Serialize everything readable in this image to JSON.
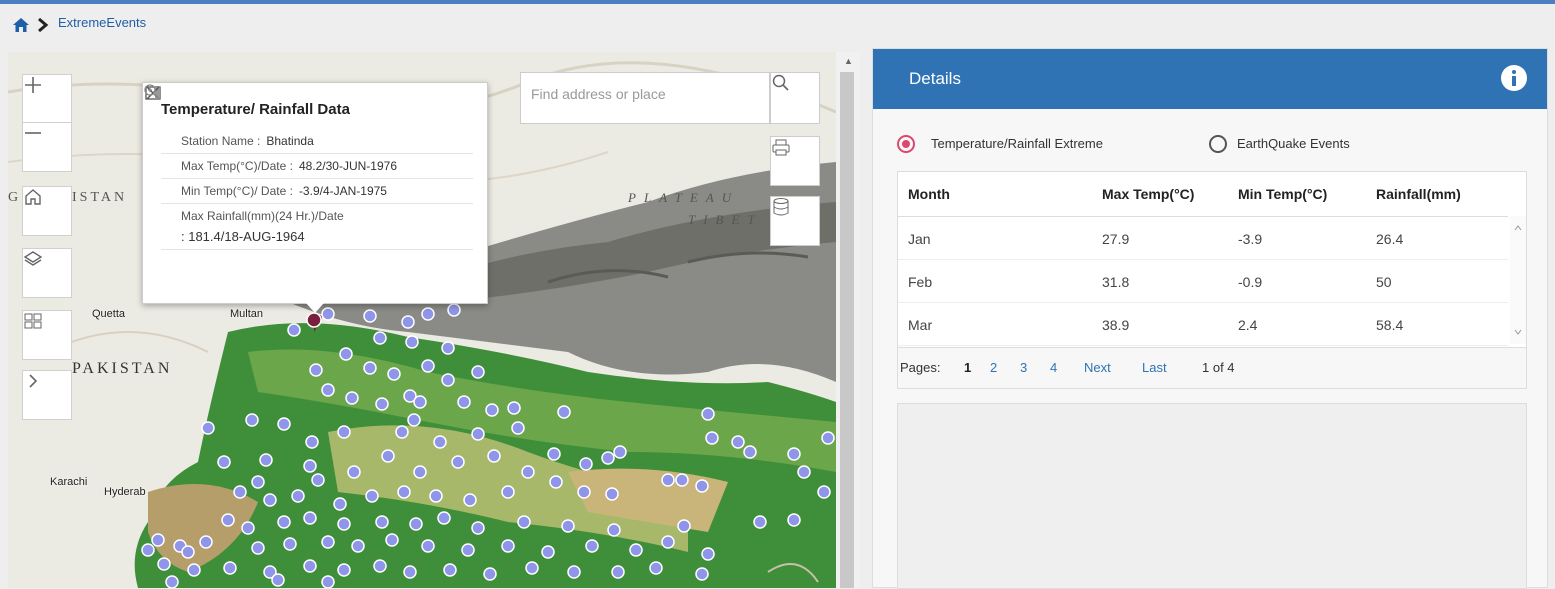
{
  "breadcrumb": {
    "home_icon": "home-icon",
    "current": "ExtremeEvents"
  },
  "map": {
    "labels": {
      "plateau1": "PLATEAU",
      "plateau2": "TIBET",
      "pakistan": "PAKISTAN",
      "stan": "ISTAN",
      "g": "G"
    },
    "cities": {
      "quetta": "Quetta",
      "multan": "Multan",
      "karachi": "Karachi",
      "hyderabad": "Hyderab"
    },
    "search": {
      "placeholder": "Find address or place"
    },
    "controls": [
      "zoom-in-icon",
      "zoom-out-icon",
      "home-icon",
      "layers-icon",
      "basemap-gallery-icon",
      "expand-icon",
      "search-icon",
      "print-icon",
      "database-icon"
    ],
    "popup": {
      "title": "Temperature/ Rainfall Data",
      "station_label": "Station Name :",
      "station_value": "Bhatinda",
      "max_temp_label": "Max Temp(°C)/Date :",
      "max_temp_value": "48.2/30-JUN-1976",
      "min_temp_label": "Min Temp(°C)/ Date :",
      "min_temp_value": "-3.9/4-JAN-1975",
      "rain_label": "Max Rainfall(mm)(24 Hr.)/Date",
      "rain_value": ":  181.4/18-AUG-1964"
    },
    "marker_color": "#8f95e8",
    "selected_marker_color": "#7a1f3d"
  },
  "details": {
    "title": "Details",
    "accent": "#2f73b5",
    "radio": [
      {
        "label": "Temperature/Rainfall Extreme",
        "selected": true
      },
      {
        "label": "EarthQuake Events",
        "selected": false
      }
    ],
    "columns": [
      "Month",
      "Max Temp(°C)",
      "Min Temp(°C)",
      "Rainfall(mm)"
    ],
    "rows": [
      {
        "month": "Jan",
        "max": "27.9",
        "min": "-3.9",
        "rain": "26.4"
      },
      {
        "month": "Feb",
        "max": "31.8",
        "min": "-0.9",
        "rain": "50"
      },
      {
        "month": "Mar",
        "max": "38.9",
        "min": "2.4",
        "rain": "58.4"
      }
    ],
    "pager": {
      "label": "Pages:",
      "p1": "1",
      "p2": "2",
      "p3": "3",
      "p4": "4",
      "next": "Next",
      "last": "Last",
      "status": "1 of 4"
    }
  }
}
